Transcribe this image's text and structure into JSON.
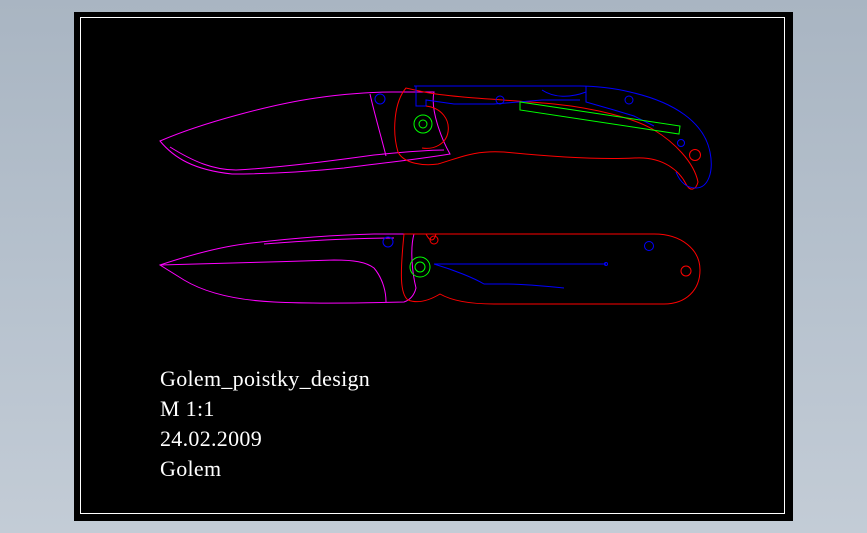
{
  "title_block": {
    "name": "Golem_poistky_design",
    "scale": "M  1:1",
    "date": "24.02.2009",
    "author": "Golem"
  },
  "colors": {
    "background": "#000000",
    "frame": "#ffffff",
    "blade": "#ff00ff",
    "handle_outline": "#ff0000",
    "liner": "#0000ff",
    "pivot": "#00ff00",
    "text": "#ffffff"
  }
}
